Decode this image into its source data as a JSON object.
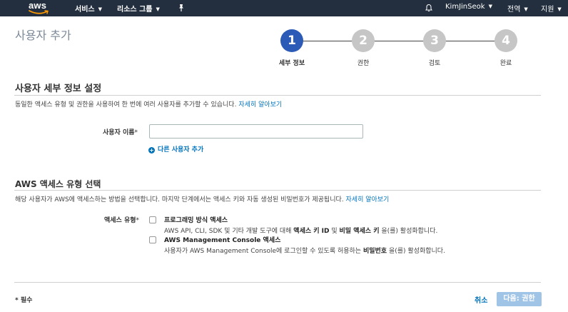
{
  "nav": {
    "logo_text": "aws",
    "services": "서비스",
    "resource_groups": "리소스 그룹",
    "user": "KimJinSeok",
    "region": "전역",
    "support": "지원"
  },
  "page": {
    "title": "사용자 추가"
  },
  "stepper": {
    "steps": [
      {
        "number": "1",
        "label": "세부 정보",
        "active": true
      },
      {
        "number": "2",
        "label": "권한",
        "active": false
      },
      {
        "number": "3",
        "label": "검토",
        "active": false
      },
      {
        "number": "4",
        "label": "완료",
        "active": false
      }
    ]
  },
  "details": {
    "title": "사용자 세부 정보 설정",
    "desc": "동일한 액세스 유형 및 권한을 사용하여 한 번에 여러 사용자를 추가할 수 있습니다.",
    "learn_more": "자세히 알아보기",
    "username_label": "사용자 이름",
    "required_mark": "*",
    "username_value": "",
    "add_user": "다른 사용자 추가"
  },
  "access": {
    "title": "AWS 액세스 유형 선택",
    "desc": "해당 사용자가 AWS에 액세스하는 방법을 선택합니다. 마지막 단계에서는 액세스 키와 자동 생성된 비밀번호가 제공됩니다.",
    "learn_more": "자세히 알아보기",
    "type_label": "액세스 유형",
    "options": [
      {
        "title": "프로그래밍 방식 액세스",
        "desc_prefix": "AWS API, CLI, SDK 및 기타 개발 도구에 대해 ",
        "desc_bold1": "액세스 키 ID",
        "desc_mid": " 및 ",
        "desc_bold2": "비밀 액세스 키",
        "desc_suffix": " 을(를) 활성화합니다.",
        "checked": false
      },
      {
        "title": "AWS Management Console 액세스",
        "desc_prefix": "사용자가 AWS Management Console에 로그인할 수 있도록 허용하는 ",
        "desc_bold1": "비밀번호",
        "desc_suffix": " 을(를) 활성화합니다.",
        "checked": false
      }
    ]
  },
  "footer": {
    "required_note": "* 필수",
    "cancel": "취소",
    "next": "다음: 권한"
  },
  "colors": {
    "nav_bg": "#232f3e",
    "step_active": "#2b5ab7",
    "step_inactive": "#c6c6c6",
    "link": "#0073bb",
    "next_disabled": "#a0c4e6"
  }
}
